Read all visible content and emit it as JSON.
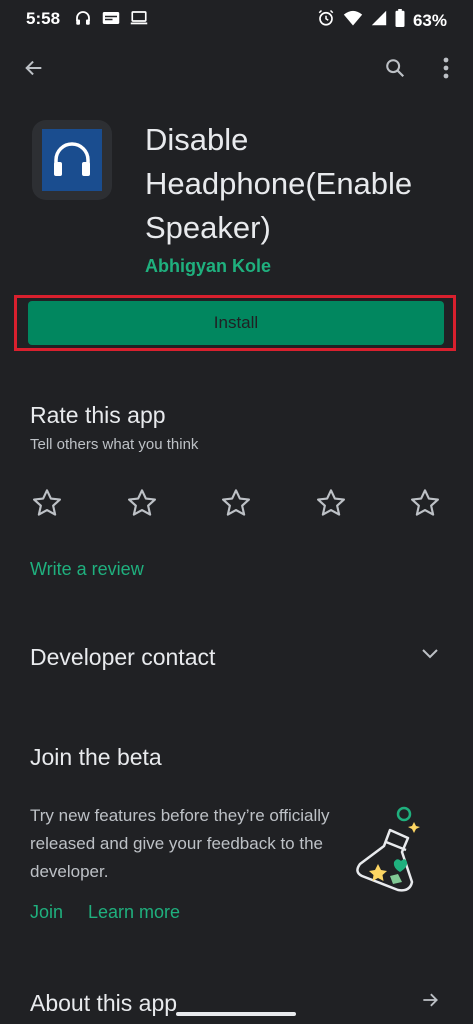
{
  "status_bar": {
    "time": "5:58",
    "battery": "63%"
  },
  "toolbar": {
    "back_icon": "arrow-back-icon",
    "search_icon": "search-icon",
    "more_icon": "more-vert-icon"
  },
  "app": {
    "title": "Disable Headphone(Enable Speaker)",
    "developer": "Abhigyan Kole",
    "icon": "headphones-icon",
    "icon_color": "#1a4d8f"
  },
  "install": {
    "label": "Install",
    "color": "#01875f",
    "highlight_color": "#d9202e"
  },
  "rate": {
    "title": "Rate this app",
    "subtitle": "Tell others what you think",
    "write_review": "Write a review",
    "stars": 5
  },
  "developer_contact": {
    "title": "Developer contact"
  },
  "beta": {
    "title": "Join the beta",
    "description": "Try new features before they’re officially released and give your feedback to the developer.",
    "join": "Join",
    "learn_more": "Learn more"
  },
  "about": {
    "title": "About this app"
  },
  "accent": "#1fb07e"
}
